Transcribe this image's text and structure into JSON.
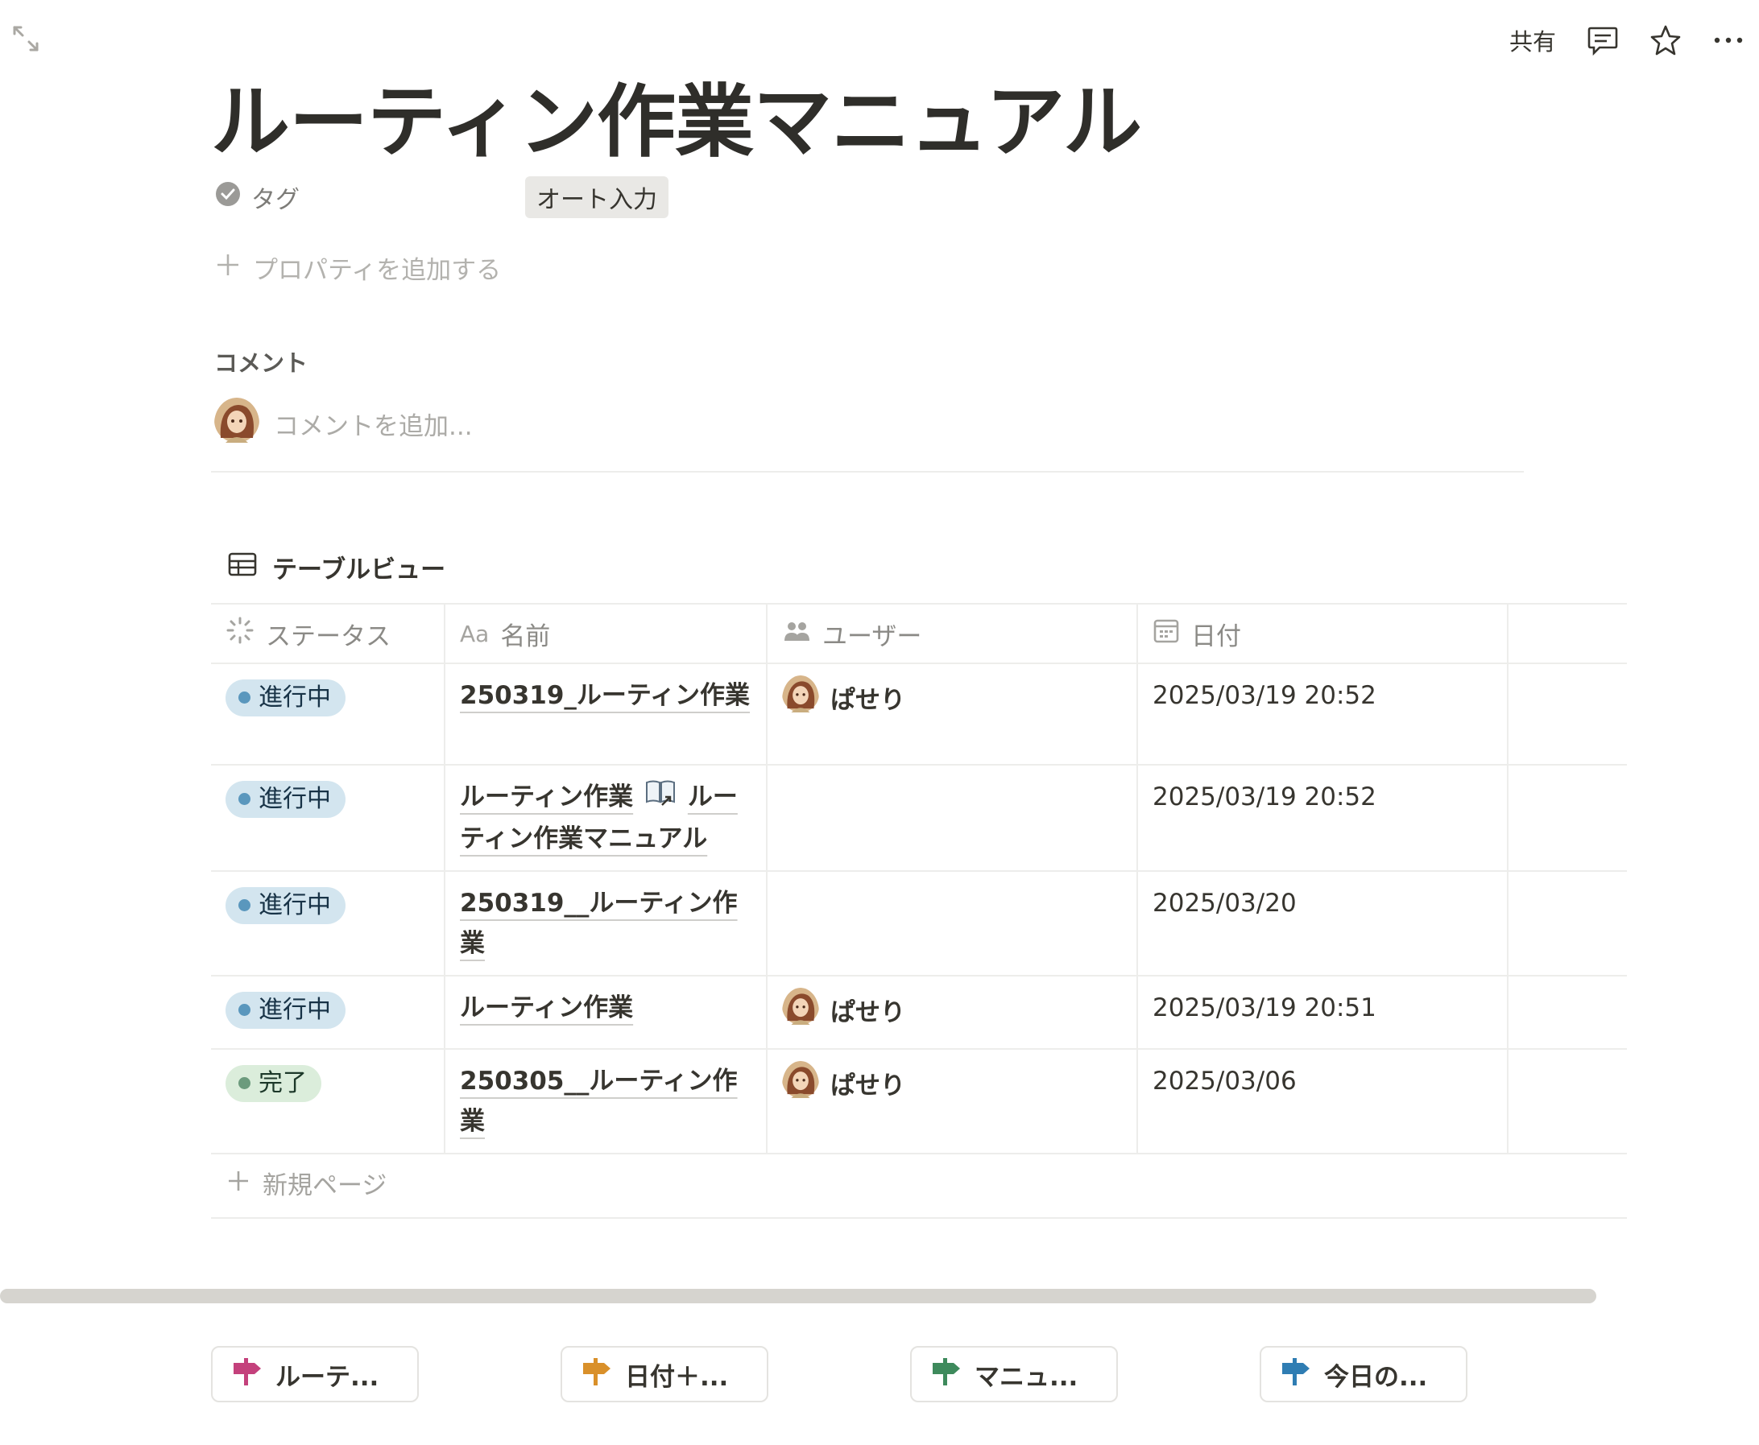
{
  "toolbar": {
    "share_label": "共有"
  },
  "page": {
    "title": "ルーティン作業マニュアル"
  },
  "properties": {
    "tag_label": "タグ",
    "tag_value": "オート入力",
    "add_property_label": "プロパティを追加する"
  },
  "comments": {
    "heading": "コメント",
    "placeholder": "コメントを追加..."
  },
  "table_view": {
    "title": "テーブルビュー",
    "columns": [
      {
        "label": "ステータス",
        "icon": "status-icon"
      },
      {
        "label": "名前",
        "icon": "text-aa-icon",
        "icon_text": "Aa"
      },
      {
        "label": "ユーザー",
        "icon": "people-icon"
      },
      {
        "label": "日付",
        "icon": "calendar-icon"
      }
    ],
    "rows": [
      {
        "status": "進行中",
        "name": "250319_ルーティン作業",
        "user": "ぱせり",
        "date": "2025/03/19 20:52"
      },
      {
        "status": "進行中",
        "name": "ルーティン作業",
        "link_name": "ルーティン作業マニュアル",
        "user": "",
        "date": "2025/03/19 20:52"
      },
      {
        "status": "進行中",
        "name": "250319__ルーティン作業",
        "user": "",
        "date": "2025/03/20"
      },
      {
        "status": "進行中",
        "name": "ルーティン作業",
        "user": "ぱせり",
        "date": "2025/03/19 20:51"
      },
      {
        "status": "完了",
        "name": "250305__ルーティン作業",
        "user": "ぱせり",
        "date": "2025/03/06"
      }
    ],
    "new_page_label": "新規ページ"
  },
  "buttons": [
    {
      "label": "ルーテ...",
      "color": "#c4417c"
    },
    {
      "label": "日付＋...",
      "color": "#d9902a"
    },
    {
      "label": "マニュ...",
      "color": "#3e8a5c"
    },
    {
      "label": "今日の...",
      "color": "#2f7db3"
    }
  ],
  "colors": {
    "status_in_progress_bg": "#d3e5ef",
    "status_done_bg": "#dbeddb"
  }
}
